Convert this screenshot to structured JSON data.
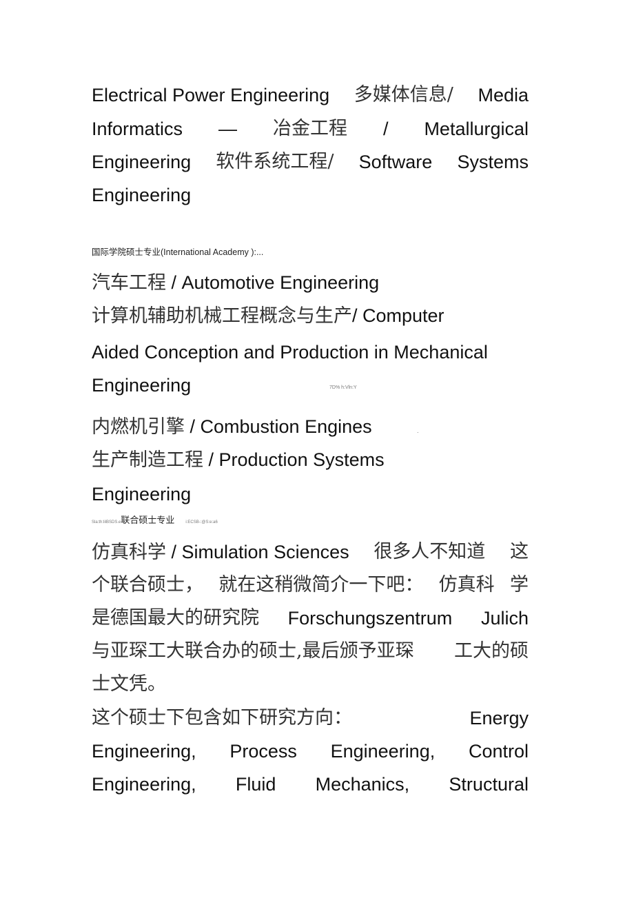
{
  "block1": {
    "line1": [
      "Electrical Power Engineering",
      "多媒体信息/",
      "Media"
    ],
    "line2": [
      "Informatics",
      "—",
      "冶金工程",
      "/",
      "Metallurgical"
    ],
    "line3": [
      "Engineering",
      "软件系统工程/",
      "Software",
      "Systems"
    ],
    "line4": "Engineering"
  },
  "section_heading": "国际学院硕士专业(International Academy ):...",
  "block2": {
    "auto_cn": "汽车工程",
    "auto_en": " / Automotive Engineering",
    "cad_cn": "计算机辅助机械工程概念与生产",
    "cad_en": "/ Computer",
    "cad_line2": "Aided Conception and Production in Mechanical",
    "cad_line3": "Engineering",
    "noise1": "7D% h:Vln:Y",
    "comb_cn": "内燃机引擎",
    "comb_en": " / Combustion Engines",
    "noise_dot": ".",
    "prod_cn": "生产制造工程",
    "prod_en": " / Production Systems",
    "prod_line2": "Engineering"
  },
  "joint_heading": {
    "prefix_noise": "Sla:th:lilBSDS.e",
    "label": "联合硕士专业",
    "suffix_noise": "i:ECSB-:@S:e:a6"
  },
  "block3": {
    "line1": [
      "仿真科学",
      " / Simulation Sciences",
      "很多人不知道",
      "这"
    ],
    "line2": [
      "个联合硕士，",
      "就在这稍微简介一下吧：",
      "仿真科",
      "学"
    ],
    "line3": [
      "是德国最大的研究院",
      "Forschungszentrum",
      "Julich"
    ],
    "line4": [
      "与亚琛工大联合办的硕士,最后颁予亚琛",
      "工大的硕"
    ],
    "line5": "士文凭。",
    "line6": [
      "这个硕士下包含如下研究方向：",
      "Energy"
    ],
    "line7": [
      "Engineering,",
      "Process",
      "Engineering,",
      "Control"
    ],
    "line8": [
      "Engineering,",
      "Fluid",
      "Mechanics,",
      "Structural"
    ]
  }
}
